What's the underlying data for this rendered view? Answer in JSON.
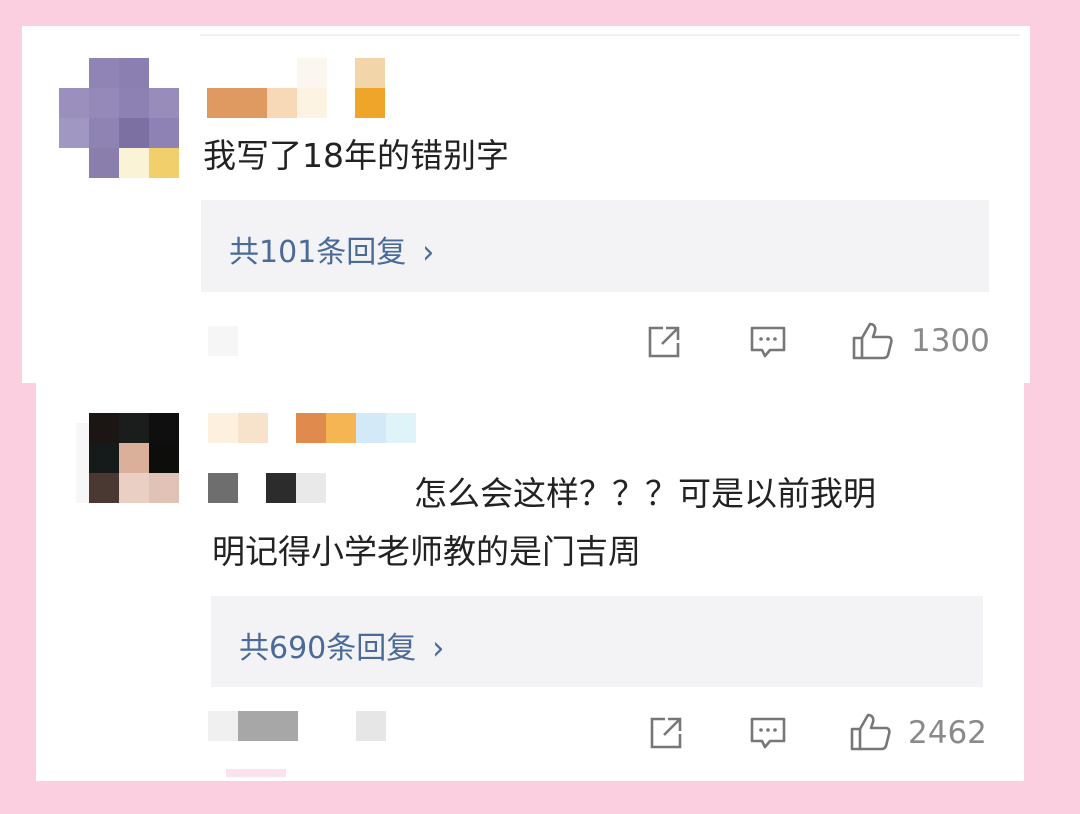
{
  "comments": [
    {
      "text": "我写了18年的错别字",
      "replies_label": "共101条回复",
      "chevron": "›",
      "likes": "1300",
      "icons": [
        "share-icon",
        "comment-icon",
        "thumbs-up-icon"
      ]
    },
    {
      "text_line1": "怎么会这样？？？可是以前我明",
      "text_line2": "明记得小学老师教的是门吉周",
      "replies_label": "共690条回复",
      "chevron": "›",
      "likes": "2462",
      "icons": [
        "share-icon",
        "comment-icon",
        "thumbs-up-icon"
      ]
    }
  ],
  "colors": {
    "page_background": "#fccfe0",
    "card_background": "#ffffff",
    "reply_box_background": "#f3f3f5",
    "reply_link_color": "#4a6a9a",
    "count_color": "#8a8a8a"
  }
}
